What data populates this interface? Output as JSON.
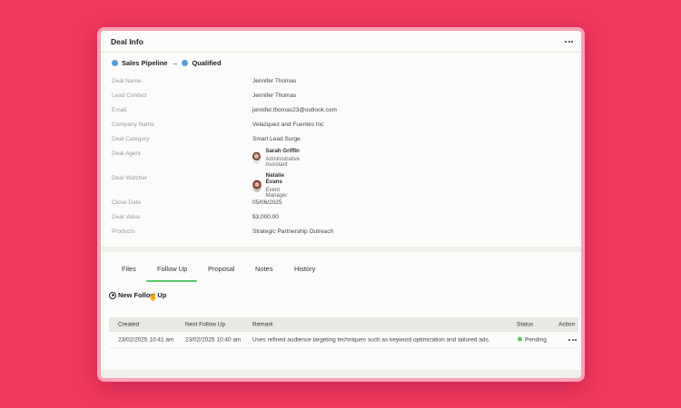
{
  "header": {
    "title": "Deal Info",
    "menu_icon": "more-horizontal-icon"
  },
  "pipeline": {
    "from": "Sales Pipeline",
    "to": "Qualified",
    "stage_color": "#5b9bd5"
  },
  "fields": {
    "deal_name": {
      "label": "Deal Name",
      "value": "Jennifer Thomas"
    },
    "lead_contact": {
      "label": "Lead Contact",
      "value": "Jennifer Thomas"
    },
    "email": {
      "label": "Email",
      "value": "jennifer.thomas23@outlook.com"
    },
    "company_name": {
      "label": "Company Name",
      "value": "Velazquez and Fuentes Inc"
    },
    "deal_category": {
      "label": "Deal Category",
      "value": "Smart Lead Surge"
    },
    "deal_agent": {
      "label": "Deal Agent",
      "name": "Sarah Griffin",
      "role": "Administrative Assistant"
    },
    "deal_watcher": {
      "label": "Deal Watcher",
      "name": "Natalie Evans",
      "role": "Event Manager"
    },
    "close_date": {
      "label": "Close Date",
      "value": "05/06/2025"
    },
    "deal_value": {
      "label": "Deal Value",
      "value": "$3,000.00"
    },
    "products": {
      "label": "Products",
      "value": "Strategic Partnership Outreach"
    }
  },
  "tabs": [
    "Files",
    "Follow Up",
    "Proposal",
    "Notes",
    "History"
  ],
  "active_tab": "Follow Up",
  "accent_color": "#59c36a",
  "follow_up": {
    "new_label": "New Follow Up",
    "columns": [
      "Created",
      "Next Follow Up",
      "Remark",
      "Status",
      "Action"
    ],
    "rows": [
      {
        "created": "23/02/2025 10:41 am",
        "next": "23/02/2025 10:40 am",
        "remark": "Uses refined audience targeting techniques such as keyword optimization and tailored ads.",
        "status": "Pending"
      }
    ]
  }
}
